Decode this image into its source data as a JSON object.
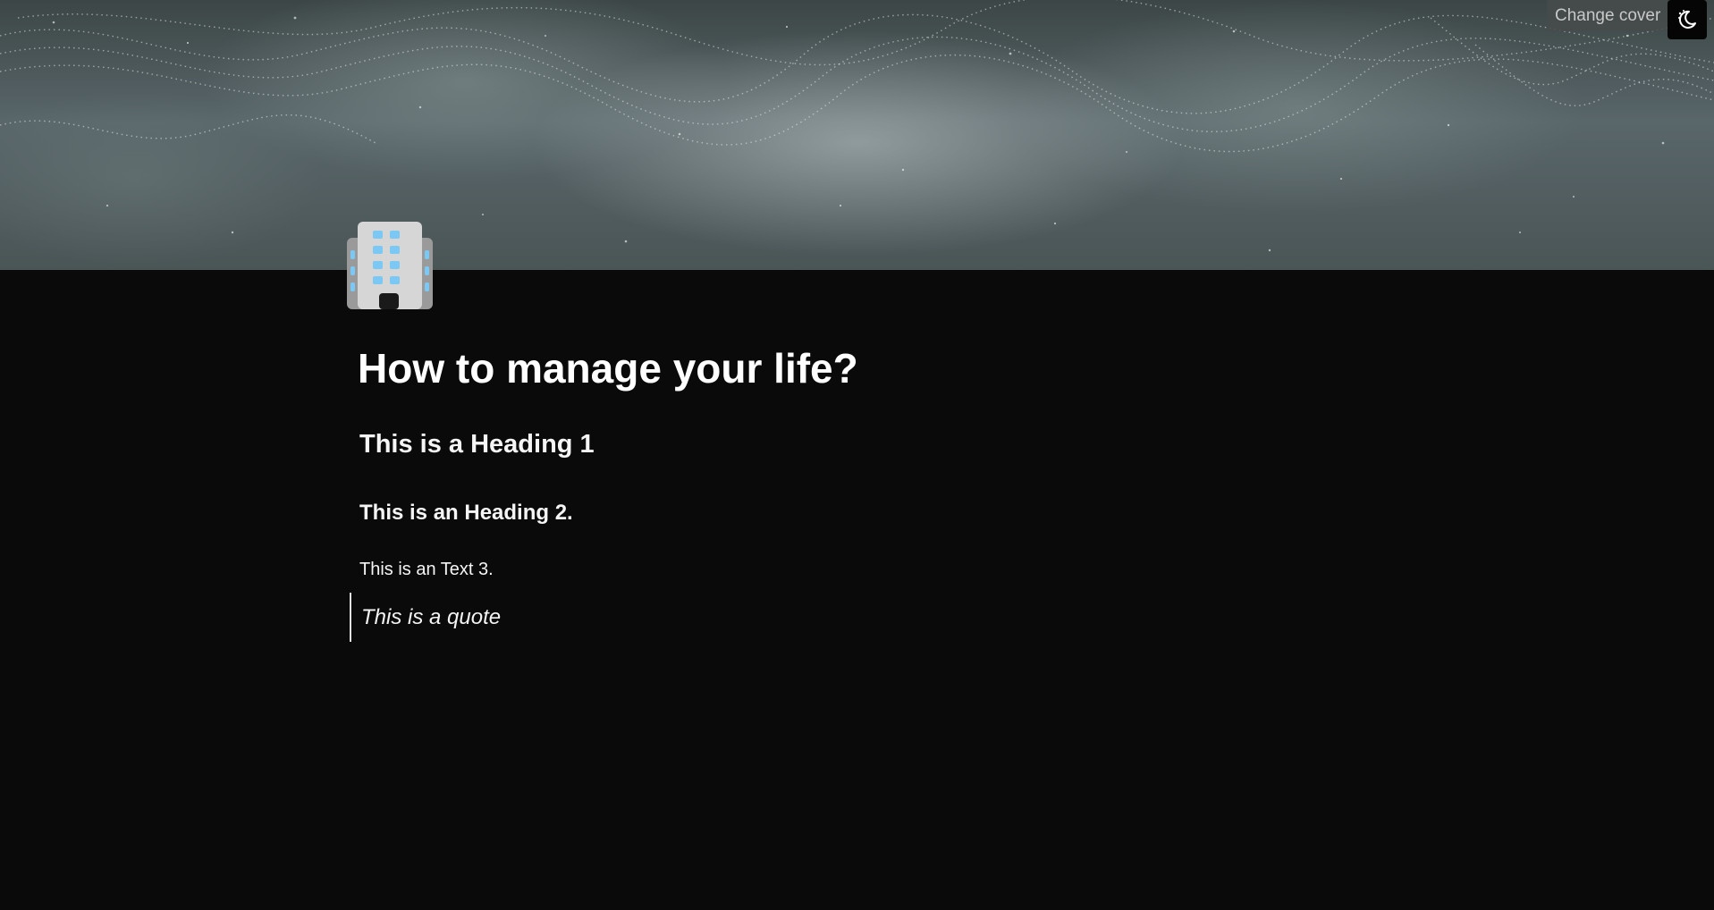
{
  "header": {
    "change_cover_label": "Change cover",
    "theme_toggle_icon": "moon-icon"
  },
  "page": {
    "icon": "office-building-icon",
    "title": "How to manage your life?",
    "blocks": {
      "heading1": "This is a Heading 1",
      "heading2": "This is an Heading 2.",
      "text3": "This is an Text 3.",
      "quote": "This is a quote"
    }
  },
  "colors": {
    "background": "#0a0a0a",
    "text": "#ffffff",
    "building_window": "#7cc8f4"
  }
}
